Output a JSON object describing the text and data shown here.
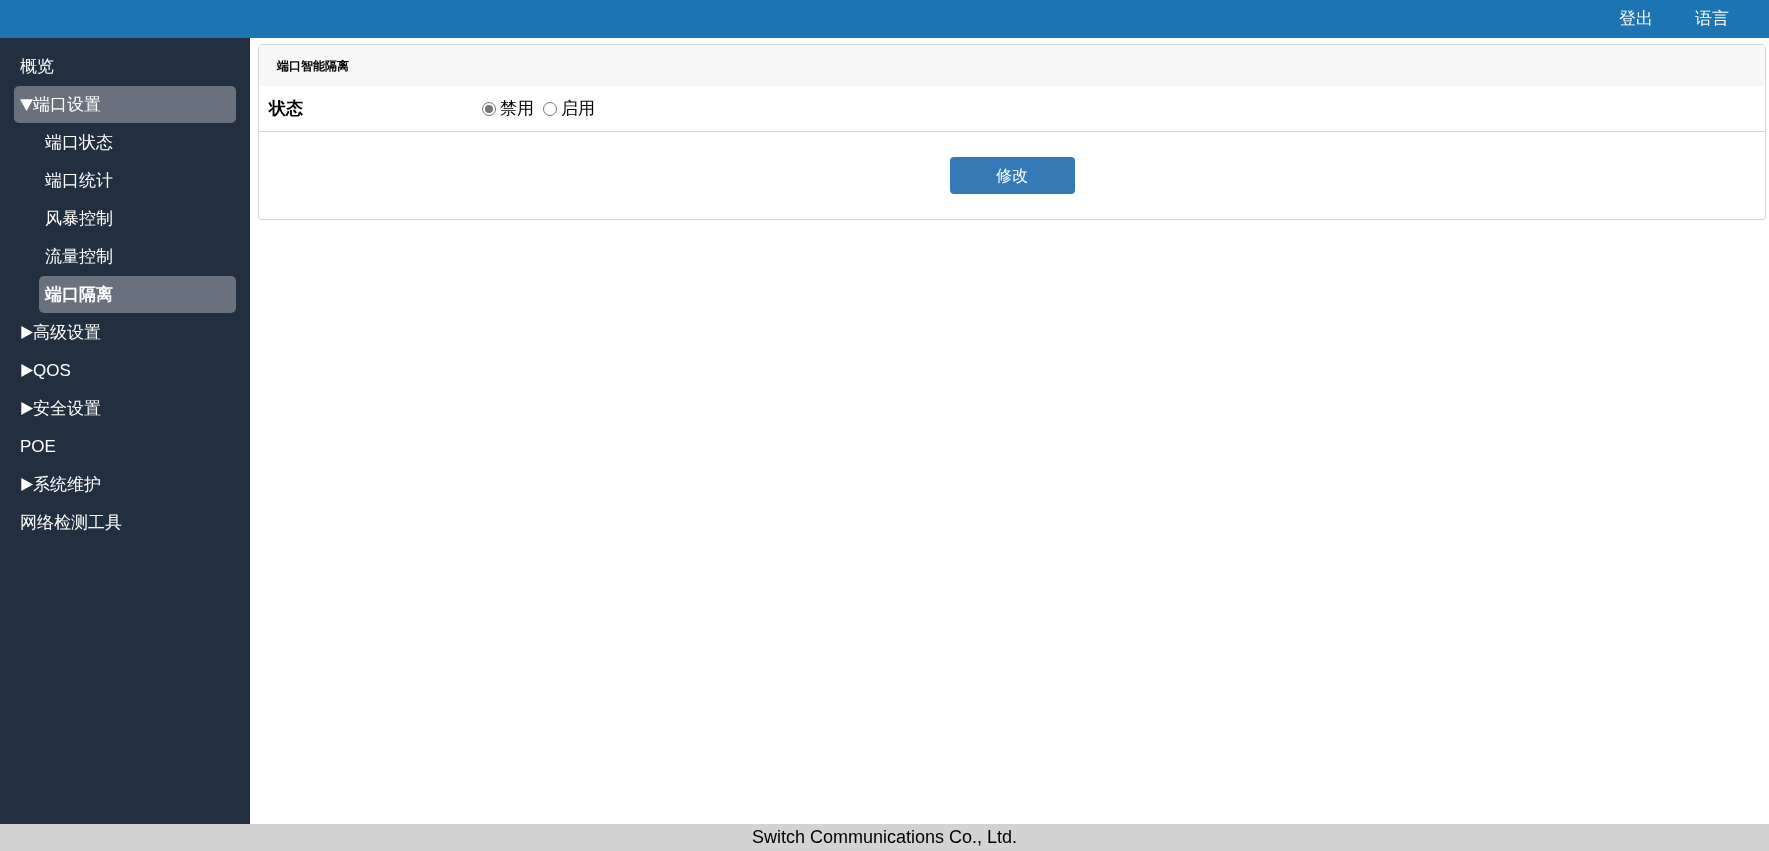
{
  "header": {
    "links": [
      "登出",
      "语言"
    ]
  },
  "sidebar": {
    "items": [
      {
        "kind": "link",
        "label": "概览",
        "selected": false
      },
      {
        "kind": "group",
        "label": "端口设置",
        "expanded": true,
        "selected": true,
        "children": [
          {
            "label": "端口状态",
            "selected": false
          },
          {
            "label": "端口统计",
            "selected": false
          },
          {
            "label": "风暴控制",
            "selected": false
          },
          {
            "label": "流量控制",
            "selected": false
          },
          {
            "label": "端口隔离",
            "selected": true
          }
        ]
      },
      {
        "kind": "group",
        "label": "高级设置",
        "expanded": false,
        "selected": false
      },
      {
        "kind": "group",
        "label": "QOS",
        "expanded": false,
        "selected": false
      },
      {
        "kind": "group",
        "label": "安全设置",
        "expanded": false,
        "selected": false
      },
      {
        "kind": "link",
        "label": "POE",
        "selected": false
      },
      {
        "kind": "group",
        "label": "系统维护",
        "expanded": false,
        "selected": false
      },
      {
        "kind": "link",
        "label": "网络检测工具",
        "selected": false
      }
    ]
  },
  "panel": {
    "title": "端口智能隔离",
    "field": {
      "label": "状态",
      "options": [
        {
          "label": "禁用",
          "selected": true
        },
        {
          "label": "启用",
          "selected": false
        }
      ]
    },
    "button": "修改"
  },
  "footer": "Switch Communications Co., Ltd."
}
